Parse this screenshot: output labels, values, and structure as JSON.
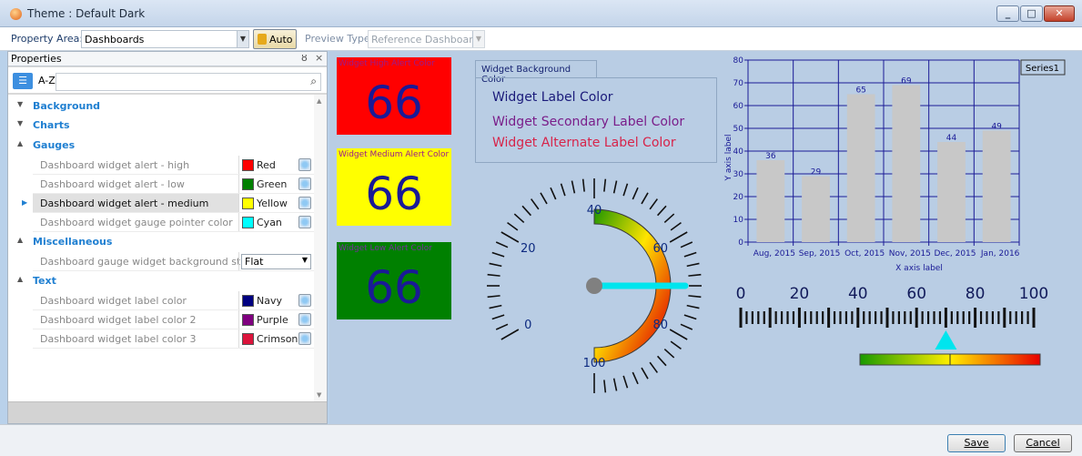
{
  "window": {
    "title": "Theme : Default Dark"
  },
  "toolbar": {
    "property_area_label": "Property Area:",
    "property_area_value": "Dashboards",
    "auto_label": "Auto",
    "preview_type_label": "Preview Type:",
    "preview_type_value": "Reference Dashboard"
  },
  "properties_panel": {
    "title": "Properties",
    "pin": "ȣ",
    "close": "×",
    "sort_label": "A-Z",
    "search_placeholder": "",
    "categories": {
      "background": "Background",
      "charts": "Charts",
      "gauges": "Gauges",
      "miscellaneous": "Miscellaneous",
      "text": "Text"
    },
    "gauges_rows": [
      {
        "name": "Dashboard widget alert - high",
        "color_name": "Red",
        "color": "#ff0000"
      },
      {
        "name": "Dashboard widget alert - low",
        "color_name": "Green",
        "color": "#008000"
      },
      {
        "name": "Dashboard widget alert - medium",
        "color_name": "Yellow",
        "color": "#ffff00",
        "selected": true
      },
      {
        "name": "Dashboard widget gauge pointer color",
        "color_name": "Cyan",
        "color": "#00ffff"
      }
    ],
    "misc_rows": [
      {
        "name": "Dashboard gauge widget background style",
        "value": "Flat"
      }
    ],
    "text_rows": [
      {
        "name": "Dashboard widget label color",
        "color_name": "Navy",
        "color": "#000080"
      },
      {
        "name": "Dashboard widget label color 2",
        "color_name": "Purple",
        "color": "#800080"
      },
      {
        "name": "Dashboard widget label color 3",
        "color_name": "Crimson",
        "color": "#dc143c"
      }
    ]
  },
  "preview": {
    "alerts": [
      {
        "label": "Widget High Alert Color",
        "value": "66",
        "bg": "#ff0000",
        "label_color": "#9a1a8c"
      },
      {
        "label": "Widget Medium Alert Color",
        "value": "66",
        "bg": "#ffff00",
        "label_color": "#9a1a8c"
      },
      {
        "label": "Widget Low Alert Color",
        "value": "66",
        "bg": "#008000",
        "label_color": "#7a2ea0"
      }
    ],
    "background_tab": "Widget Background Color",
    "label_color_text": "Widget Label Color",
    "secondary_label_text": "Widget Secondary Label Color",
    "alternate_label_text": "Widget Alternate Label Color",
    "gauge": {
      "labels": [
        "0",
        "20",
        "40",
        "60",
        "80",
        "100"
      ],
      "value": 70,
      "min": 0,
      "max": 100,
      "pointer_color": "#00e5ee"
    },
    "linear_gauge": {
      "labels": [
        "0",
        "20",
        "40",
        "60",
        "80",
        "100"
      ],
      "value": 70
    }
  },
  "chart_data": {
    "type": "bar",
    "categories": [
      "Aug, 2015",
      "Sep, 2015",
      "Oct, 2015",
      "Nov, 2015",
      "Dec, 2015",
      "Jan, 2016"
    ],
    "series": [
      {
        "name": "Series1",
        "values": [
          36,
          29,
          65,
          69,
          44,
          49
        ]
      }
    ],
    "xlabel": "X axis label",
    "ylabel": "Y axis label",
    "ylim": [
      0,
      80
    ],
    "yticks": [
      "0",
      "10",
      "20",
      "30",
      "40",
      "50",
      "60",
      "70",
      "80"
    ],
    "grid": true,
    "legend": "top-right",
    "bar_color": "#c8c8c8",
    "axis_color": "#1a1a96"
  },
  "footer": {
    "save_label": "Save",
    "cancel_label": "Cancel"
  }
}
